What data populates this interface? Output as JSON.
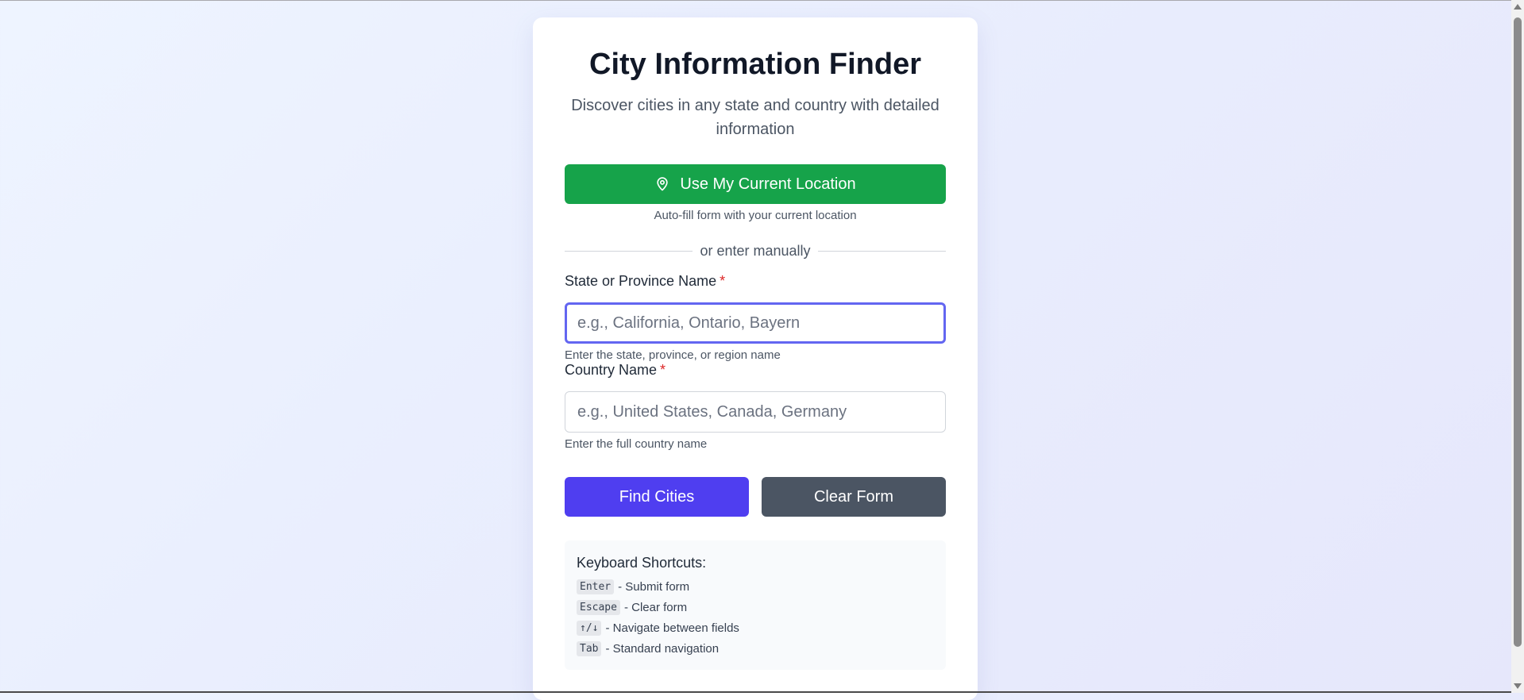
{
  "header": {
    "title": "City Information Finder",
    "subtitle": "Discover cities in any state and country with detailed information"
  },
  "location": {
    "button_label": "Use My Current Location",
    "icon": "map-pin-icon",
    "hint": "Auto-fill form with your current location"
  },
  "divider": {
    "text": "or enter manually"
  },
  "form": {
    "state": {
      "label": "State or Province Name",
      "required_mark": "*",
      "placeholder": "e.g., California, Ontario, Bayern",
      "value": "",
      "hint": "Enter the state, province, or region name"
    },
    "country": {
      "label": "Country Name",
      "required_mark": "*",
      "placeholder": "e.g., United States, Canada, Germany",
      "value": "",
      "hint": "Enter the full country name"
    },
    "find_label": "Find Cities",
    "clear_label": "Clear Form"
  },
  "shortcuts": {
    "title": "Keyboard Shortcuts:",
    "items": [
      {
        "key": "Enter",
        "desc": "- Submit form"
      },
      {
        "key": "Escape",
        "desc": "- Clear form"
      },
      {
        "key": "↑/↓",
        "desc": "- Navigate between fields"
      },
      {
        "key": "Tab",
        "desc": "- Standard navigation"
      }
    ]
  },
  "colors": {
    "location_button": "#16a34a",
    "find_button": "#4f3ef0",
    "clear_button": "#4b5563",
    "focus_ring": "#6366f1",
    "required": "#dc2626"
  }
}
